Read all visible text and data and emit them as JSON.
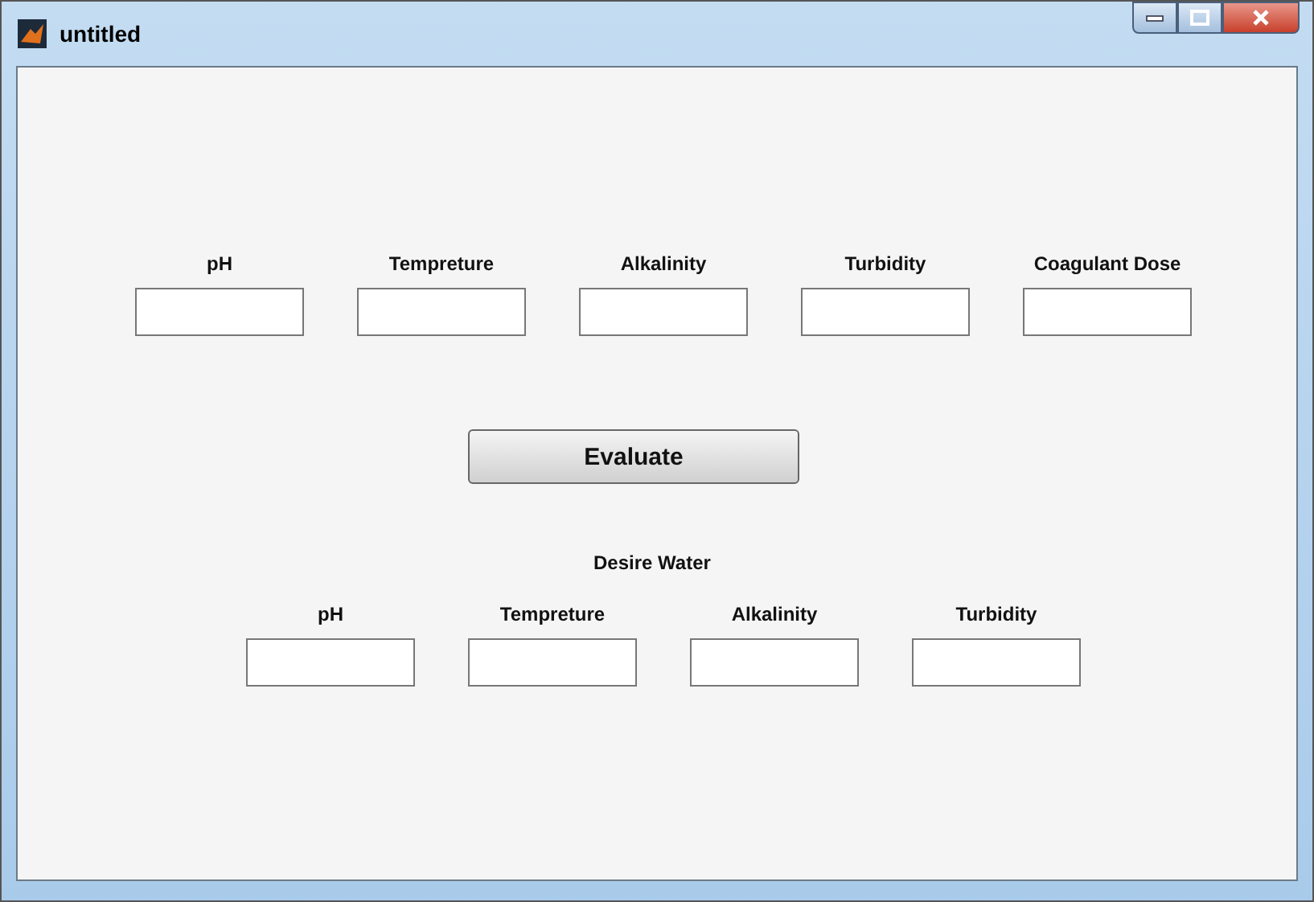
{
  "window": {
    "title": "untitled"
  },
  "inputs": [
    {
      "label": "pH"
    },
    {
      "label": "Tempreture"
    },
    {
      "label": "Alkalinity"
    },
    {
      "label": "Turbidity"
    },
    {
      "label": "Coagulant Dose"
    }
  ],
  "button": {
    "label": "Evaluate"
  },
  "output_title": "Desire Water",
  "outputs": [
    {
      "label": "pH"
    },
    {
      "label": "Tempreture"
    },
    {
      "label": "Alkalinity"
    },
    {
      "label": "Turbidity"
    }
  ]
}
